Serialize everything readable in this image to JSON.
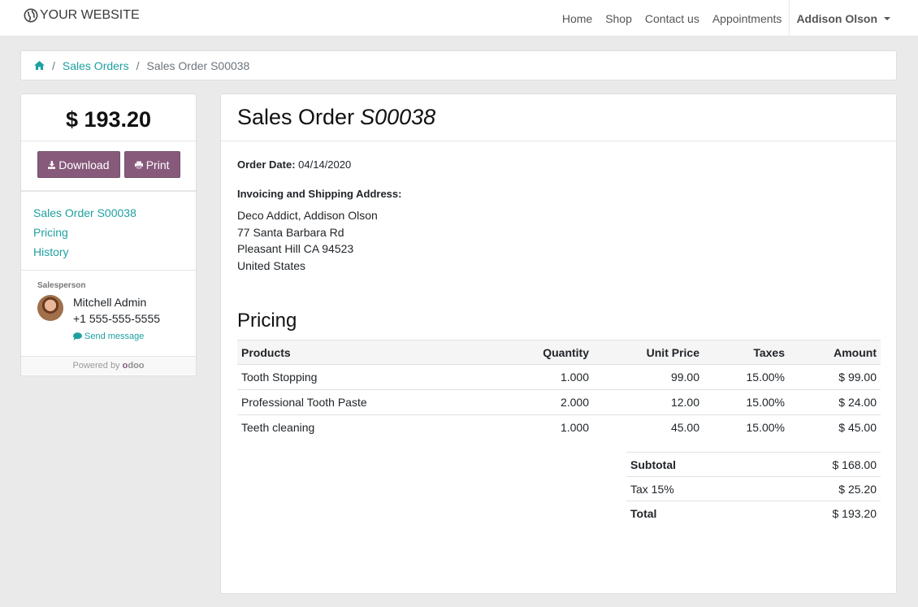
{
  "navbar": {
    "brand": "YOUR WEBSITE",
    "links": [
      "Home",
      "Shop",
      "Contact us",
      "Appointments"
    ],
    "user": "Addison Olson"
  },
  "breadcrumb": {
    "home_icon": "home-icon",
    "sales_orders": "Sales Orders",
    "current": "Sales Order S00038"
  },
  "sidebar": {
    "total": "$ 193.20",
    "download_label": "Download",
    "print_label": "Print",
    "links": [
      "Sales Order S00038",
      "Pricing",
      "History"
    ],
    "salesperson_label": "Salesperson",
    "salesperson_name": "Mitchell Admin",
    "salesperson_phone": "+1 555-555-5555",
    "send_message": "Send message",
    "powered_by": "Powered by",
    "powered_brand": "odoo"
  },
  "order": {
    "title_prefix": "Sales Order",
    "number": "S00038",
    "date_label": "Order Date:",
    "date": "04/14/2020",
    "address_title": "Invoicing and Shipping Address:",
    "address_lines": [
      "Deco Addict, Addison Olson",
      "77 Santa Barbara Rd",
      "Pleasant Hill CA 94523",
      "United States"
    ]
  },
  "pricing": {
    "title": "Pricing",
    "headers": [
      "Products",
      "Quantity",
      "Unit Price",
      "Taxes",
      "Amount"
    ],
    "rows": [
      [
        "Tooth Stopping",
        "1.000",
        "99.00",
        "15.00%",
        "$ 99.00"
      ],
      [
        "Professional Tooth Paste",
        "2.000",
        "12.00",
        "15.00%",
        "$ 24.00"
      ],
      [
        "Teeth cleaning",
        "1.000",
        "45.00",
        "15.00%",
        "$ 45.00"
      ]
    ],
    "subtotal_label": "Subtotal",
    "subtotal": "$ 168.00",
    "tax_label": "Tax 15%",
    "tax": "$ 25.20",
    "total_label": "Total",
    "total": "$ 193.20"
  },
  "colors": {
    "accent": "#1fa0a0",
    "button": "#875a7b"
  }
}
